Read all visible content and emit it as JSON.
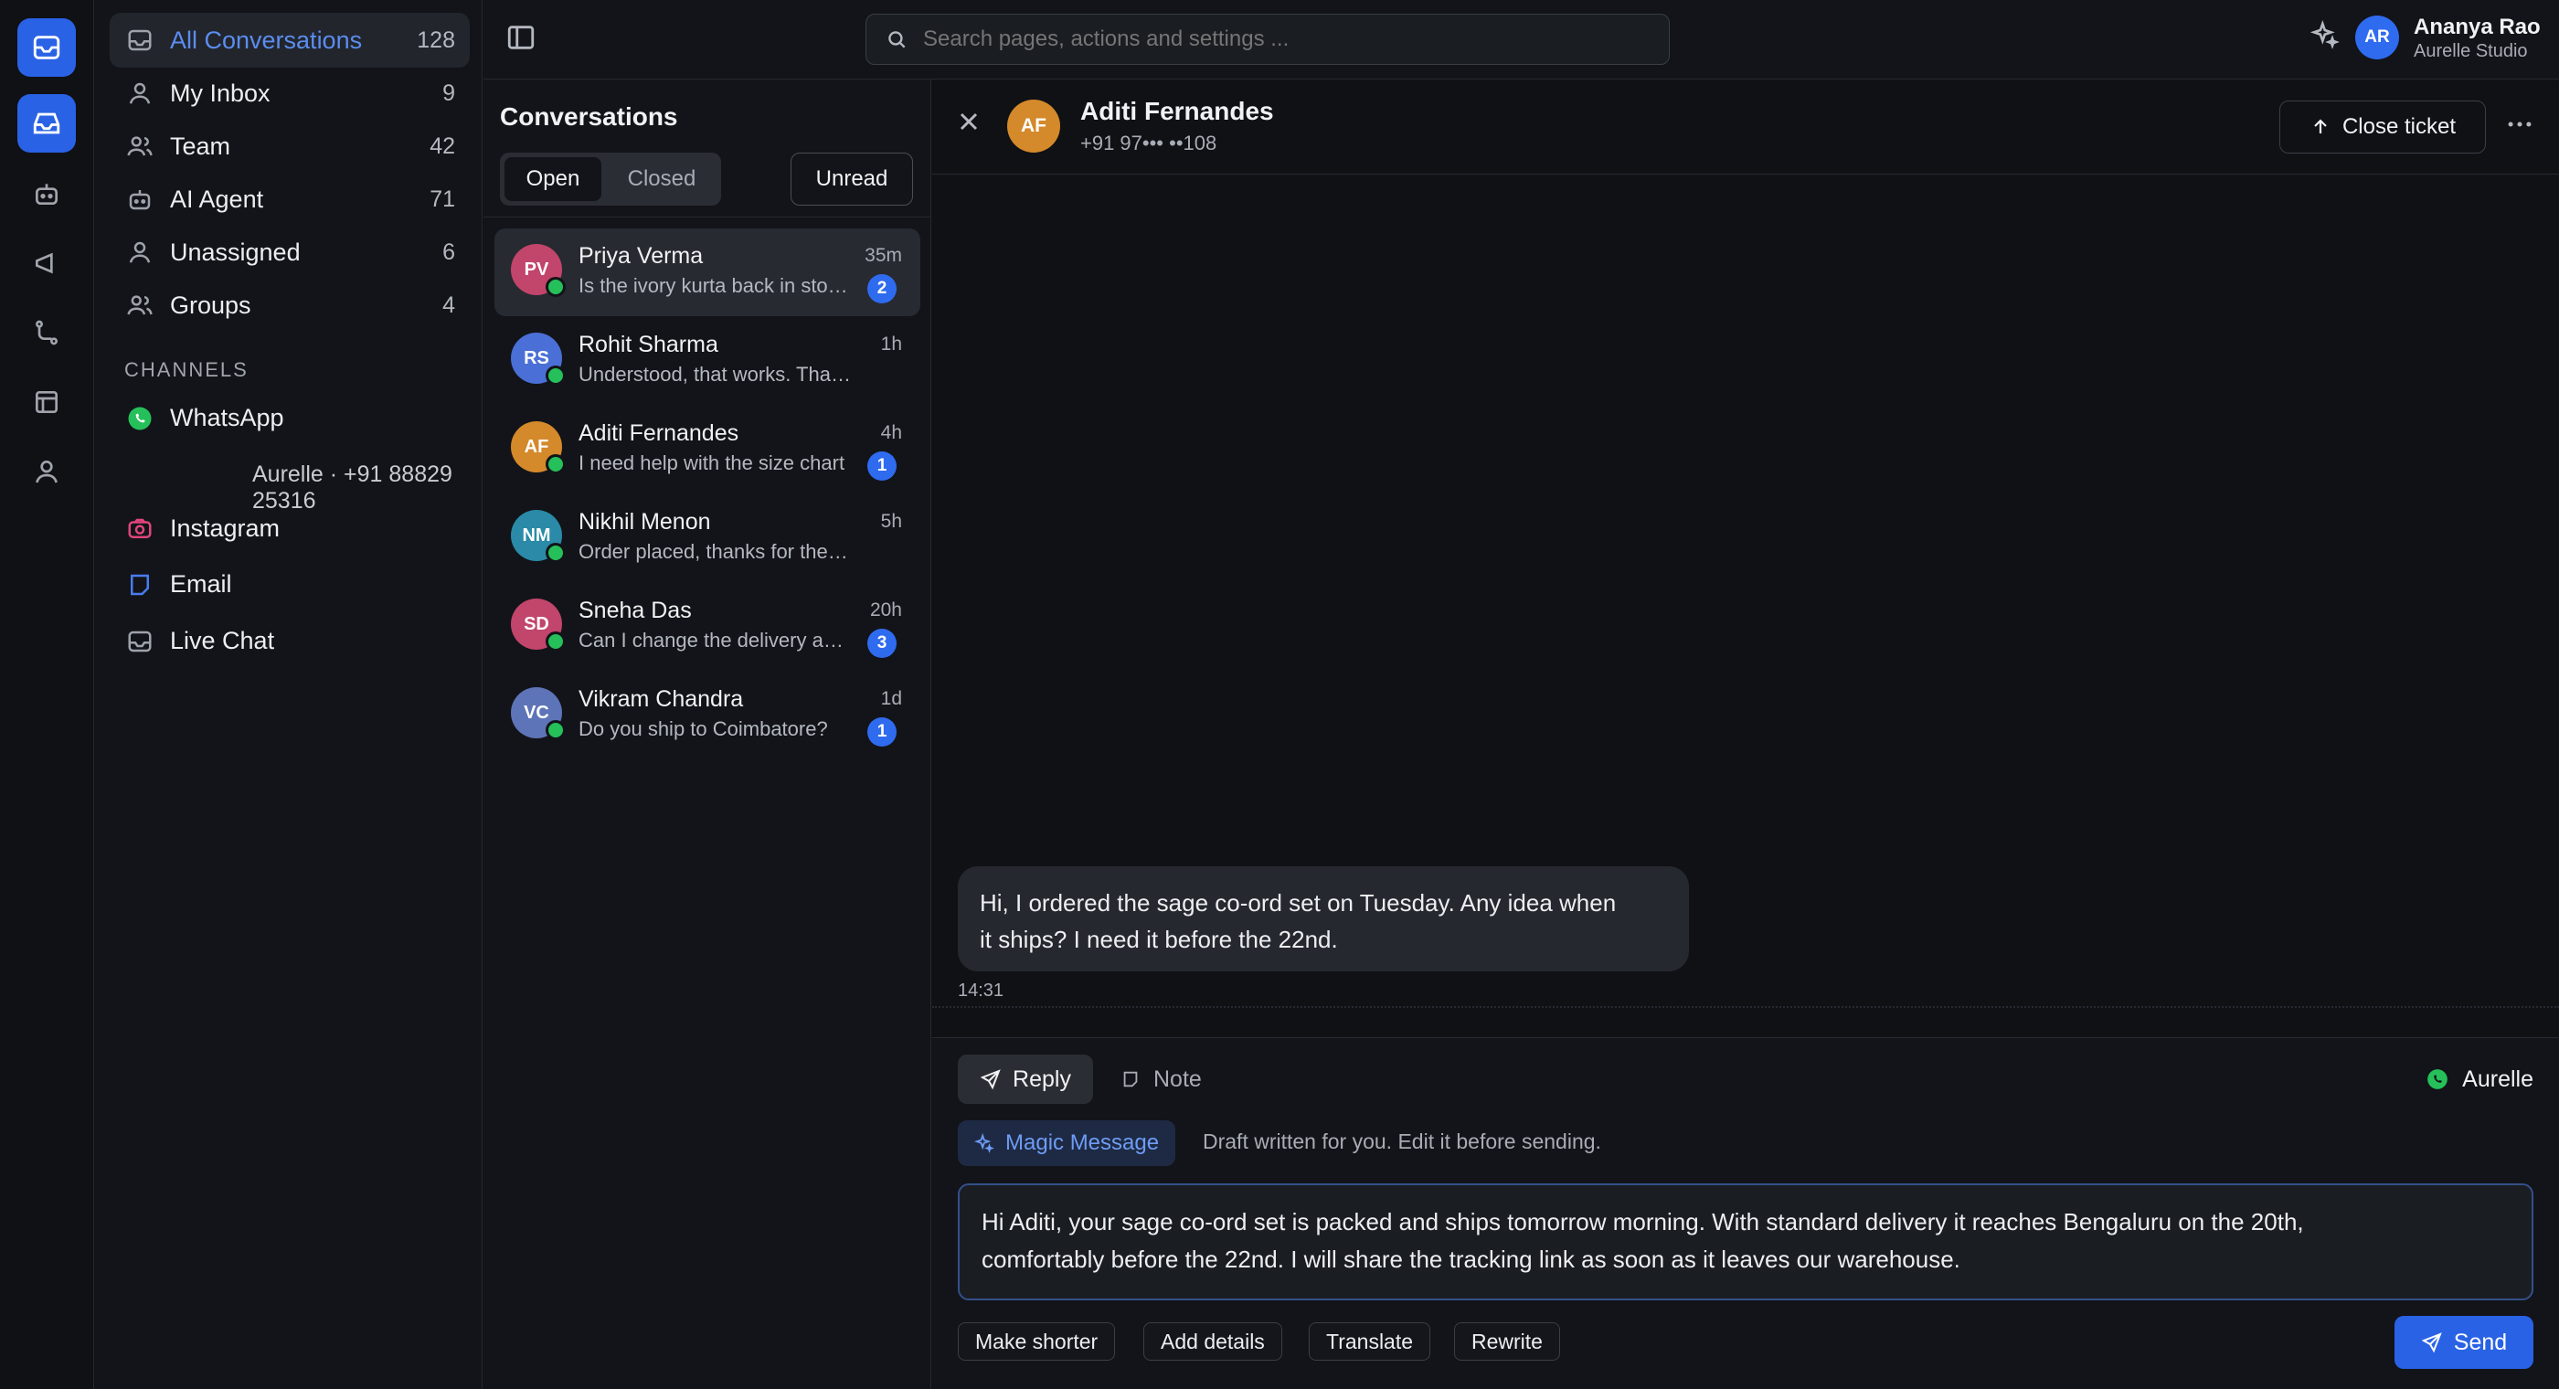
{
  "topbar": {
    "search_placeholder": "Search pages, actions and settings ...",
    "user": {
      "initials": "AR",
      "name": "Ananya Rao",
      "org": "Aurelle Studio"
    }
  },
  "rail": {
    "items": [
      "inbox-icon",
      "chat-icon",
      "bot-icon",
      "megaphone-icon",
      "workflow-icon",
      "layout-icon",
      "user-icon"
    ]
  },
  "sidebar": {
    "items": [
      {
        "label": "All Conversations",
        "count": "128",
        "icon": "inbox-icon",
        "active": true
      },
      {
        "label": "My Inbox",
        "count": "9",
        "icon": "user-icon"
      },
      {
        "label": "Team",
        "count": "42",
        "icon": "users-icon"
      },
      {
        "label": "AI Agent",
        "count": "71",
        "icon": "bot-icon"
      },
      {
        "label": "Unassigned",
        "count": "6",
        "icon": "user-icon"
      },
      {
        "label": "Groups",
        "count": "4",
        "icon": "users-icon"
      }
    ],
    "channels_heading": "CHANNELS",
    "channels": {
      "whatsapp": "WhatsApp",
      "whatsapp_number": "Aurelle · +91 88829 25316",
      "instagram": "Instagram",
      "email": "Email",
      "live_chat": "Live Chat"
    }
  },
  "conversations": {
    "title": "Conversations",
    "tabs": {
      "open": "Open",
      "closed": "Closed"
    },
    "unread_label": "Unread",
    "items": [
      {
        "initials": "PV",
        "name": "Priya Verma",
        "time": "35m",
        "preview": "Is the ivory kurta back in stock?",
        "badge": "2",
        "color": "#c2456b"
      },
      {
        "initials": "RS",
        "name": "Rohit Sharma",
        "time": "1h",
        "preview": "Understood, that works. Thanks!",
        "badge": "",
        "color": "#4a6fd6"
      },
      {
        "initials": "AF",
        "name": "Aditi Fernandes",
        "time": "4h",
        "preview": "I need help with the size chart",
        "badge": "1",
        "color": "#d4892a"
      },
      {
        "initials": "NM",
        "name": "Nikhil Menon",
        "time": "5h",
        "preview": "Order placed, thanks for the help",
        "badge": "",
        "color": "#2a8aa8"
      },
      {
        "initials": "SD",
        "name": "Sneha Das",
        "time": "20h",
        "preview": "Can I change the delivery address?",
        "badge": "3",
        "color": "#c2456b"
      },
      {
        "initials": "VC",
        "name": "Vikram Chandra",
        "time": "1d",
        "preview": "Do you ship to Coimbatore?",
        "badge": "1",
        "color": "#5e74b8"
      }
    ]
  },
  "chat": {
    "contact_initials": "AF",
    "contact_name": "Aditi Fernandes",
    "contact_phone": "+91 97••• ••108",
    "close_ticket": "Close ticket",
    "message_line1": "Hi, I ordered the sage co-ord set on Tuesday. Any idea when",
    "message_line2": "it ships? I need it before the 22nd.",
    "message_time": "14:31",
    "reply_tab": "Reply",
    "note_tab": "Note",
    "channel_name": "Aurelle",
    "magic_label": "Magic Message",
    "magic_hint": "Draft written for you. Edit it before sending.",
    "draft_line1": "Hi Aditi, your sage co-ord set is packed and ships tomorrow morning. With standard delivery it reaches Bengaluru on the 20th,",
    "draft_line2": "comfortably before the 22nd. I will share the tracking link as soon as it leaves our warehouse.",
    "chips": [
      "Make shorter",
      "Add details",
      "Translate",
      "Rewrite"
    ],
    "send_label": "Send"
  },
  "colors": {
    "accent": "#2a62e6",
    "active_text": "#5b8def",
    "whatsapp": "#25c05a",
    "instagram": "#e0457b",
    "email": "#4a7bf0"
  }
}
